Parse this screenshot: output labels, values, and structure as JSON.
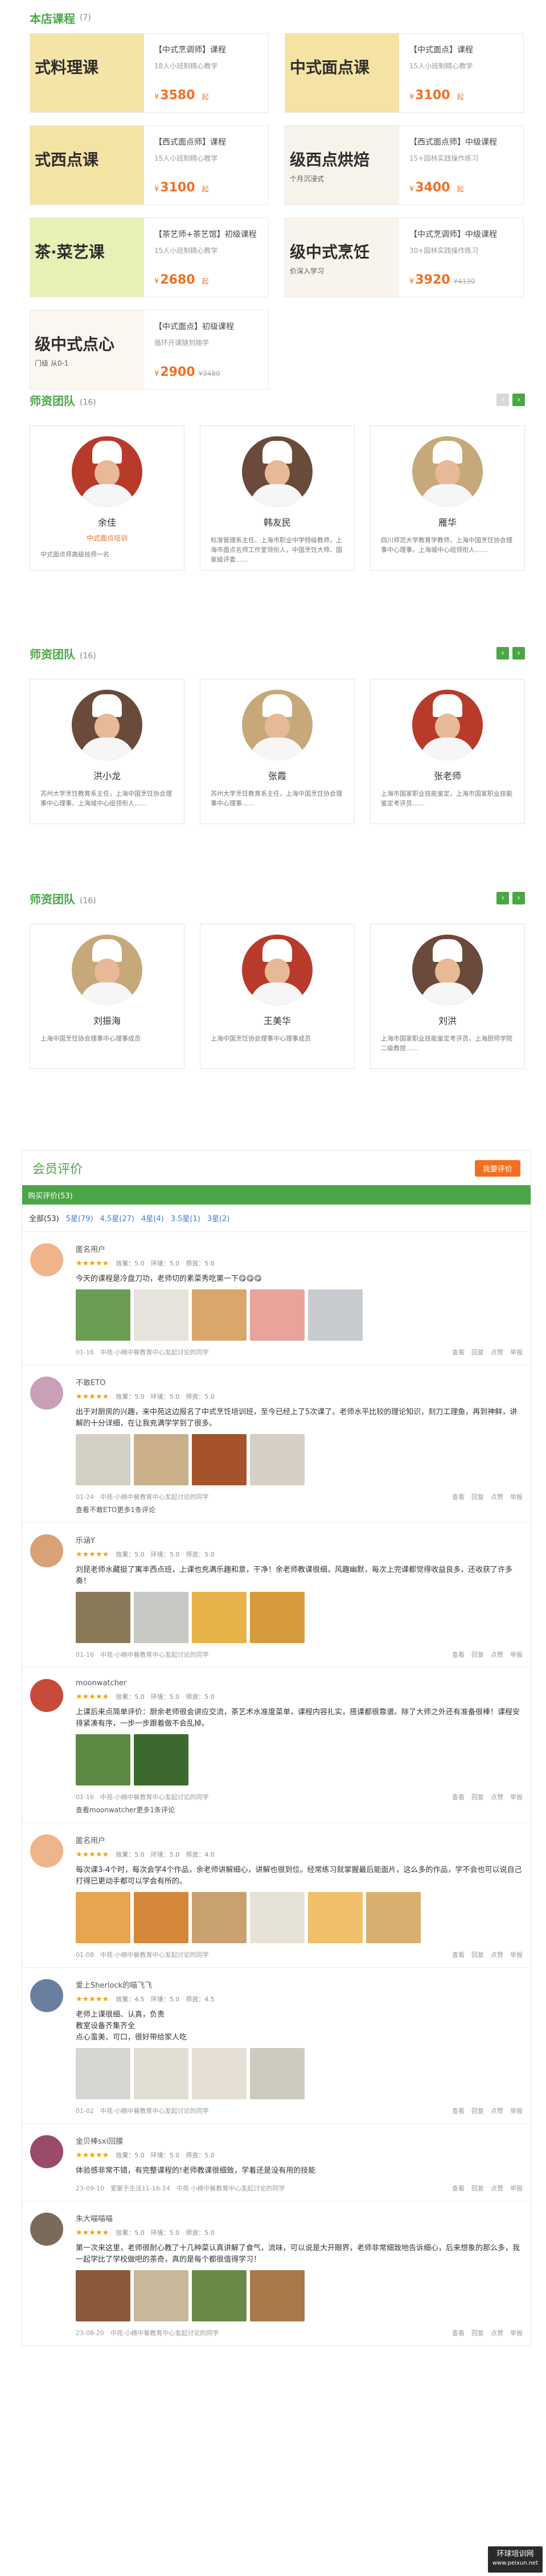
{
  "store": {
    "title": "本店课程",
    "count": "(7)"
  },
  "courses": [
    {
      "thumb_word": "式料理课",
      "thumb_sub": "",
      "thumb_color": "#f5e4a8",
      "title": "【中式烹调师】课程",
      "desc": "18人小班制精心教学",
      "price": "3580",
      "unit": "起",
      "old": ""
    },
    {
      "thumb_word": "中式面点课",
      "thumb_sub": "",
      "thumb_color": "#f4e3a2",
      "title": "【中式面点】课程",
      "desc": "15人小班制精心教学",
      "price": "3100",
      "unit": "起",
      "old": ""
    },
    {
      "thumb_word": "式西点课",
      "thumb_sub": "",
      "thumb_color": "#f4e4a4",
      "title": "【西式面点师】课程",
      "desc": "15人小班制精心教学",
      "price": "3100",
      "unit": "起",
      "old": ""
    },
    {
      "thumb_word": "级西点烘焙",
      "thumb_sub": "个月沉浸式",
      "thumb_color": "#f7f2ea",
      "title": "【西式面点师】中级课程",
      "desc": "15+园林实践操作练习",
      "price": "3400",
      "unit": "起",
      "old": ""
    },
    {
      "thumb_word": "茶·菜艺课",
      "thumb_sub": "",
      "thumb_color": "#e9f0b5",
      "title": "【茶艺师+茶艺馆】初级课程",
      "desc": "15人小班制精心教学",
      "price": "2680",
      "unit": "起",
      "old": ""
    },
    {
      "thumb_word": "级中式烹饪",
      "thumb_sub": "价深入学习",
      "thumb_color": "#f8f4ec",
      "title": "【中式烹调师】中级课程",
      "desc": "30+园林实践操作练习",
      "price": "3920",
      "unit": "",
      "old": "¥4130"
    },
    {
      "thumb_word": "级中式点心",
      "thumb_sub": "门级 从0-1",
      "thumb_color": "#fbf7f0",
      "title": "【中式面点】初级课程",
      "desc": "循环开课随到随学",
      "price": "2900",
      "unit": "",
      "old": "¥3480"
    }
  ],
  "teams": [
    {
      "title": "师资团队",
      "count": "(16)",
      "teachers": [
        {
          "name": "余佳",
          "tag": "中式面点培训",
          "intro": "中式面点师高级技师一名"
        },
        {
          "name": "韩友民",
          "tag": "",
          "intro": "标准管理系主任、上海市职业中学特级教师，上海市面点名师工作室领衔人，中国烹饪大师、国家级评委……"
        },
        {
          "name": "雁华",
          "tag": "",
          "intro": "四川师范大学教育学教师，上海中国烹饪协会理事中心理事，上海城中心组领衔人……"
        }
      ]
    },
    {
      "title": "师资团队",
      "count": "(16)",
      "teachers": [
        {
          "name": "洪小龙",
          "tag": "",
          "intro": "苏州大学烹饪教育系主任，上海中国烹饪协会理事中心理事，上海城中心组领衔人……"
        },
        {
          "name": "张霞",
          "tag": "",
          "intro": "苏州大学烹饪教育系主任，上海中国烹饪协会理事中心理事……"
        },
        {
          "name": "张老师",
          "tag": "",
          "intro": "上海市国家职业技能鉴定，上海市国家职业技能鉴定考评员……"
        }
      ]
    },
    {
      "title": "师资团队",
      "count": "(16)",
      "teachers": [
        {
          "name": "刘振海",
          "tag": "",
          "intro": "上海中国烹饪协会理事中心理事成员"
        },
        {
          "name": "王美华",
          "tag": "",
          "intro": "上海中国烹饪协会理事中心理事成员"
        },
        {
          "name": "刘洪",
          "tag": "",
          "intro": "上海市国家职业技能鉴定考评员，上海厨师学院二级教授……"
        }
      ]
    }
  ],
  "reviews_section": {
    "title": "会员评价",
    "button": "我要评价",
    "tab": "购买评价(53)",
    "filters": [
      "全部(53)",
      "5星(79)",
      "4.5星(27)",
      "4星(4)",
      "3.5星(1)",
      "3星(2)"
    ]
  },
  "reviews": [
    {
      "user": "匿名用户",
      "stars": "★★★★★",
      "scores": "效果：5.0　环境：5.0　师资：5.0",
      "text": "今天的课程是冷盘刀功，老师切的素菜秀吃第一下😋😋😋",
      "date": "01-16",
      "org": "中苑·小楠中餐教育中心发起讨论的同学",
      "ops": [
        "查看",
        "回复",
        "点赞",
        "举报"
      ],
      "reply": "",
      "ava": "#f0b48a",
      "pics": [
        "#6a9e55",
        "#e6e2dc",
        "#d9a66b",
        "#e9a39a",
        "#c7cbcf"
      ]
    },
    {
      "user": "不敢ETO",
      "stars": "★★★★★",
      "scores": "效果：5.0　环境：5.0　师资：5.0",
      "text": "出于对厨房的兴趣，来中苑这边报名了中式烹饪培训班，至今已经上了5次课了。老师水平比较的理论知识，刻刀工理鱼，再到神鲜，讲解的十分详细，在让我充满学学到了很多。",
      "date": "01-24",
      "org": "中苑·小楠中餐教育中心发起讨论的同学",
      "ops": [
        "查看",
        "回复",
        "点赞",
        "举报"
      ],
      "reply": "查看不敢ETO更多1条评论",
      "ava": "#c9a0b8",
      "pics": [
        "#d4cfc4",
        "#c9b08a",
        "#a4532a",
        "#d6cfc3"
      ]
    },
    {
      "user": "乐涵Y",
      "stars": "★★★★★",
      "scores": "效果：5.0　环境：5.0　师资：5.0",
      "text": "刘昆老师水藏挺了寓丰西点班，上课也充满乐趣和意，干净！余老师教课很细，风趣幽默，每次上完课都觉得收益良多，还收获了许多奏！",
      "date": "01-16",
      "org": "中苑·小楠中餐教育中心发起讨论的同学",
      "ops": [
        "查看",
        "回复",
        "点赞",
        "举报"
      ],
      "reply": "",
      "ava": "#d6a276",
      "pics": [
        "#8b7a5a",
        "#c8c8c4",
        "#e8b24a",
        "#d89b3c"
      ]
    },
    {
      "user": "moonwatcher",
      "stars": "★★★★★",
      "scores": "效果：5.0　环境：5.0　师资：5.0",
      "text": "上课后来点简单评价：厨余老师很会讲应交流，茶艺术水准度菜单，课程内容扎实，搭课都很靠谱。除了大师之外还有准备很棒！课程安排紧凑有序，一步一步跟着做不会乱掉。",
      "date": "01-16",
      "org": "中苑·小楠中餐教育中心发起讨论的同学",
      "ops": [
        "查看",
        "回复",
        "点赞",
        "举报"
      ],
      "reply": "查看moonwatcher更多1条评论",
      "ava": "#c94a3a",
      "pics": [
        "#5e8a44",
        "#3c6a2e"
      ]
    },
    {
      "user": "匿名用户",
      "stars": "★★★★★",
      "scores": "效果：5.0　环境：5.0　师资：4.0",
      "text": "每次课3-4个时，每次会学4个作品，余老师讲解细心，讲解也很到位。经常练习就掌握最后能面片，这么多的作品，学不会也可以说自己打得已更动手都可以学会有所的。",
      "date": "01-08",
      "org": "中苑·小楠中餐教育中心发起讨论的同学",
      "ops": [
        "查看",
        "回复",
        "点赞",
        "举报"
      ],
      "reply": "",
      "ava": "#f0b48a",
      "pics": [
        "#e8a450",
        "#d5873a",
        "#c9a070",
        "#e6e2d6",
        "#f0c068",
        "#d7b070"
      ]
    },
    {
      "user": "爱上Sherlock的喵飞飞",
      "stars": "★★★★★",
      "scores": "效果：4.5　环境：5.0　师资：4.5",
      "text": "老师上课很细、认真，负责\n教室设备齐集齐全\n点心蛮美、可口，很好带给家人吃",
      "date": "01-02",
      "org": "中苑·小楠中餐教育中心发起讨论的同学",
      "ops": [
        "查看",
        "回复",
        "点赞",
        "举报"
      ],
      "reply": "",
      "ava": "#6a7ea0",
      "pics": [
        "#d8d6d0",
        "#e2ddd2",
        "#e6e0d4",
        "#cfcac0"
      ]
    },
    {
      "user": "金贝棒sxi回膜",
      "stars": "★★★★★",
      "scores": "效果：5.0　环境：5.0　师资：5.0",
      "text": "体验感非常不错，有完整课程的!老师教课很细致，学着还是没有用的技能",
      "date": "23-09-10",
      "org": "爱聚于生活11-16-24　中苑·小楠中餐教育中心发起讨论的同学",
      "ops": [
        "查看",
        "回复",
        "点赞",
        "举报"
      ],
      "reply": "",
      "ava": "#9a4a6a",
      "pics": []
    },
    {
      "user": "朱大喵喵喵",
      "stars": "★★★★★",
      "scores": "效果：5.0　环境：5.0　师资：5.0",
      "text": "第一次来这里，老师很耐心教了十几种菜认真讲解了食气，流味，可以说是大开眼界，老师非常细致地告诉细心，后来想象的那么多，我一起学比了学校做吧的茶奇，真的是每个都很值得学习！",
      "date": "23-08-20",
      "org": "中苑·小楠中餐教育中心发起讨论的同学",
      "ops": [
        "查看",
        "回复",
        "点赞",
        "举报"
      ],
      "reply": "",
      "ava": "#7a6a5a",
      "pics": [
        "#8a5a3a",
        "#c8b89a",
        "#6a8a4a",
        "#a87848"
      ]
    }
  ],
  "watermark": {
    "line1": "环球培训网",
    "line2": "www.peixun.net"
  }
}
